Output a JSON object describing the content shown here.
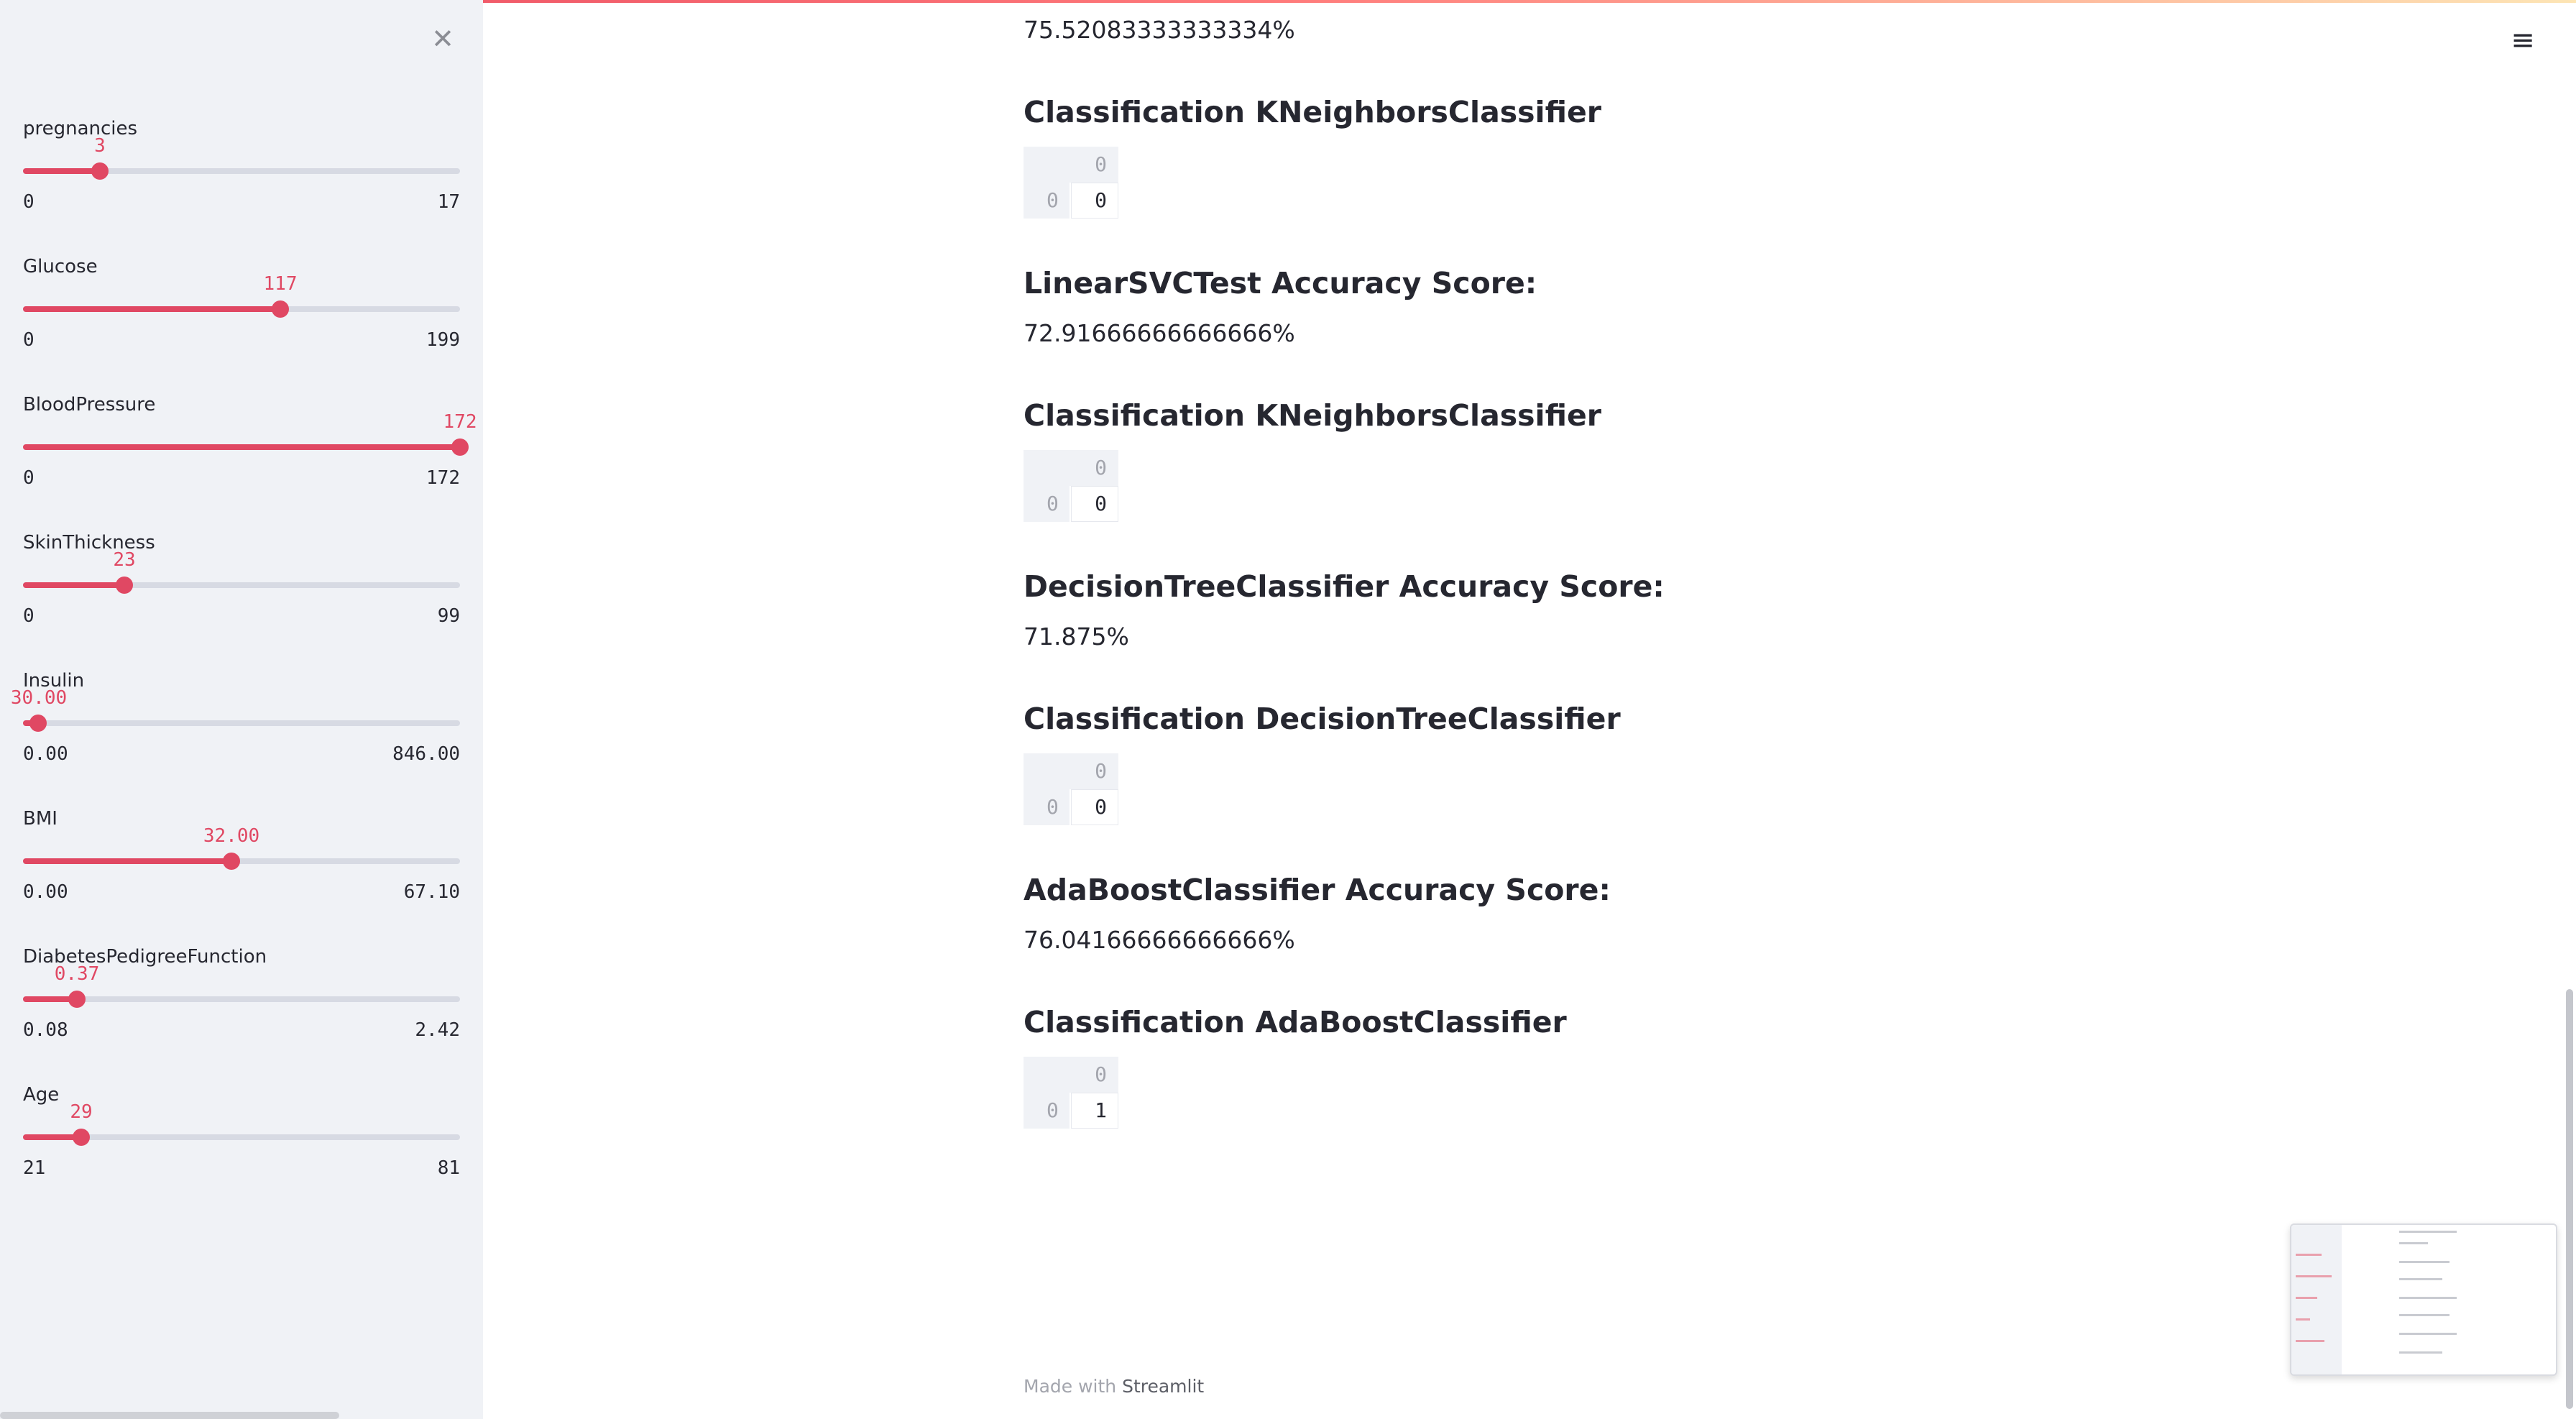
{
  "sidebar": {
    "close_glyph": "✕",
    "sliders": [
      {
        "label": "pregnancies",
        "value": "3",
        "min": "0",
        "max": "17",
        "fraction": 0.176
      },
      {
        "label": "Glucose",
        "value": "117",
        "min": "0",
        "max": "199",
        "fraction": 0.588
      },
      {
        "label": "BloodPressure",
        "value": "172",
        "min": "0",
        "max": "172",
        "fraction": 1.0
      },
      {
        "label": "SkinThickness",
        "value": "23",
        "min": "0",
        "max": "99",
        "fraction": 0.232
      },
      {
        "label": "Insulin",
        "value": "30.00",
        "min": "0.00",
        "max": "846.00",
        "fraction": 0.035
      },
      {
        "label": "BMI",
        "value": "32.00",
        "min": "0.00",
        "max": "67.10",
        "fraction": 0.477
      },
      {
        "label": "DiabetesPedigreeFunction",
        "value": "0.37",
        "min": "0.08",
        "max": "2.42",
        "fraction": 0.124
      },
      {
        "label": "Age",
        "value": "29",
        "min": "21",
        "max": "81",
        "fraction": 0.133
      }
    ]
  },
  "main": {
    "blocks": [
      {
        "kind": "text",
        "text": "75.52083333333334%"
      },
      {
        "kind": "header",
        "text": "Classification KNeighborsClassifier"
      },
      {
        "kind": "table",
        "col": "0",
        "row": "0",
        "value": "0"
      },
      {
        "kind": "header",
        "text": "LinearSVCTest Accuracy Score:"
      },
      {
        "kind": "text",
        "text": "72.91666666666666%"
      },
      {
        "kind": "header",
        "text": "Classification KNeighborsClassifier"
      },
      {
        "kind": "table",
        "col": "0",
        "row": "0",
        "value": "0"
      },
      {
        "kind": "header",
        "text": "DecisionTreeClassifier Accuracy Score:"
      },
      {
        "kind": "text",
        "text": "71.875%"
      },
      {
        "kind": "header",
        "text": "Classification DecisionTreeClassifier"
      },
      {
        "kind": "table",
        "col": "0",
        "row": "0",
        "value": "0"
      },
      {
        "kind": "header",
        "text": "AdaBoostClassifier Accuracy Score:"
      },
      {
        "kind": "text",
        "text": "76.04166666666666%"
      },
      {
        "kind": "header",
        "text": "Classification AdaBoostClassifier"
      },
      {
        "kind": "table",
        "col": "0",
        "row": "0",
        "value": "1"
      }
    ]
  },
  "footer": {
    "prefix": "Made with ",
    "brand": "Streamlit"
  },
  "menu_glyph": "≡",
  "icons": {
    "close": "close-icon",
    "menu": "hamburger-menu-icon"
  },
  "colors": {
    "accent": "#e04863",
    "sidebar_bg": "#f0f2f6",
    "text": "#262730",
    "muted": "#a3a5ad"
  }
}
